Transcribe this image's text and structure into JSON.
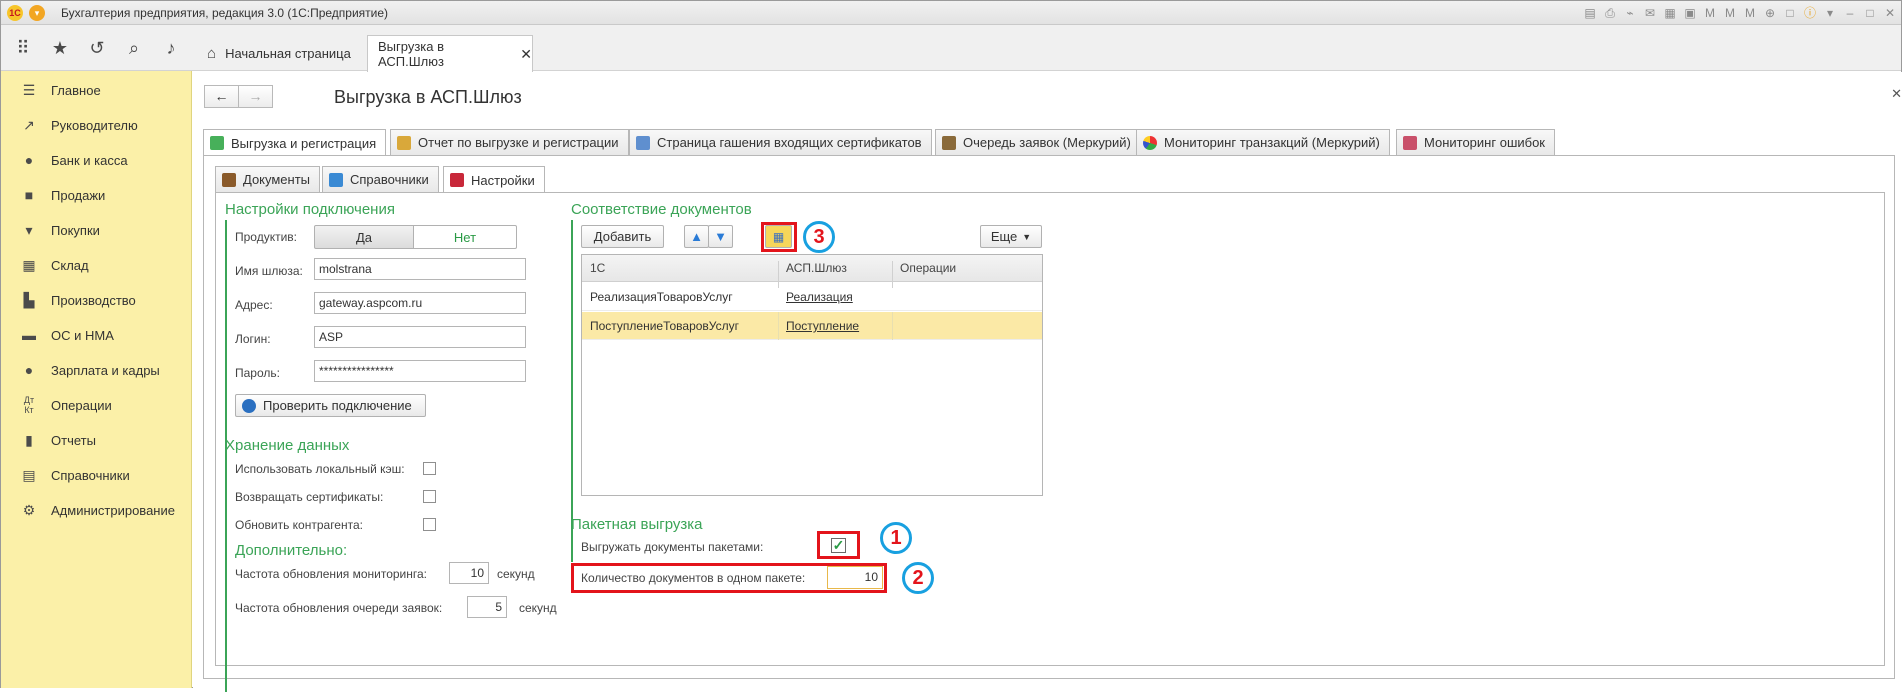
{
  "titlebar": {
    "title": "Бухгалтерия предприятия, редакция 3.0  (1С:Предприятие)",
    "logo_text": "1С"
  },
  "topnav": {
    "home_tab": "Начальная страница",
    "current_tab": "Выгрузка в АСП.Шлюз"
  },
  "sidebar": {
    "items": [
      {
        "label": "Главное",
        "icon": "menu-lines-icon"
      },
      {
        "label": "Руководителю",
        "icon": "trend-icon"
      },
      {
        "label": "Банк и касса",
        "icon": "coin-icon"
      },
      {
        "label": "Продажи",
        "icon": "bag-icon"
      },
      {
        "label": "Покупки",
        "icon": "cart-icon"
      },
      {
        "label": "Склад",
        "icon": "warehouse-icon"
      },
      {
        "label": "Производство",
        "icon": "factory-icon"
      },
      {
        "label": "ОС и НМА",
        "icon": "truck-icon"
      },
      {
        "label": "Зарплата и кадры",
        "icon": "person-icon"
      },
      {
        "label": "Операции",
        "icon": "dt-kt-icon"
      },
      {
        "label": "Отчеты",
        "icon": "report-icon"
      },
      {
        "label": "Справочники",
        "icon": "book-icon"
      },
      {
        "label": "Администрирование",
        "icon": "gear-icon"
      }
    ]
  },
  "form": {
    "title": "Выгрузка в АСП.Шлюз",
    "main_tabs": [
      "Выгрузка и регистрация",
      "Отчет по выгрузке и регистрации",
      "Страница гашения входящих сертификатов",
      "Очередь заявок (Меркурий)",
      "Мониторинг транзакций (Меркурий)",
      "Мониторинг ошибок"
    ],
    "sub_tabs": [
      "Документы",
      "Справочники",
      "Настройки"
    ]
  },
  "connection": {
    "title": "Настройки подключения",
    "productive_label": "Продуктив:",
    "yes": "Да",
    "no": "Нет",
    "gateway_label": "Имя шлюза:",
    "gateway_value": "molstrana",
    "address_label": "Адрес:",
    "address_value": "gateway.aspcom.ru",
    "login_label": "Логин:",
    "login_value": "ASP",
    "password_label": "Пароль:",
    "password_value": "****************",
    "check_button": "Проверить подключение"
  },
  "storage": {
    "title": "Хранение данных",
    "local_cache": "Использовать локальный кэш:",
    "return_certs": "Возвращать сертификаты:",
    "update_contractor": "Обновить контрагента:"
  },
  "extra": {
    "title": "Дополнительно:",
    "monitor_freq_label": "Частота обновления мониторинга:",
    "monitor_freq_value": "10",
    "queue_freq_label": "Частота обновления очереди заявок:",
    "queue_freq_value": "5",
    "unit": "секунд"
  },
  "docs_match": {
    "title": "Соответствие документов",
    "add_button": "Добавить",
    "more_button": "Еще",
    "columns": [
      "1С",
      "АСП.Шлюз",
      "Операции"
    ],
    "rows": [
      {
        "c1": "РеализацияТоваровУслуг",
        "c2": "Реализация",
        "c3": ""
      },
      {
        "c1": "ПоступлениеТоваровУслуг",
        "c2": "Поступление",
        "c3": ""
      }
    ]
  },
  "batch": {
    "title": "Пакетная выгрузка",
    "export_label": "Выгружать документы пакетами:",
    "count_label": "Количество документов в одном пакете:",
    "count_value": "10"
  },
  "markers": [
    "1",
    "2",
    "3"
  ],
  "colors": {
    "sidebar_bg": "#fbf0a8",
    "group_title": "#3ba457",
    "highlight": "#e3141b",
    "marker_ring": "#18a0e0",
    "selected_row": "#fbe9a6"
  }
}
